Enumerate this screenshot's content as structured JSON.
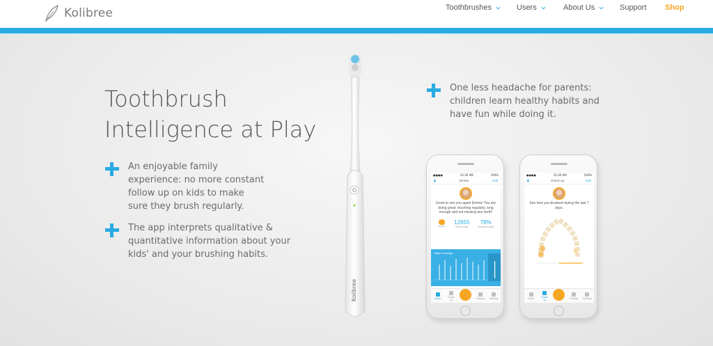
{
  "header": {
    "logo_text": "Kolibree",
    "nav": [
      {
        "label": "Toothbrushes",
        "has_dropdown": true
      },
      {
        "label": "Users",
        "has_dropdown": true
      },
      {
        "label": "About Us",
        "has_dropdown": true
      },
      {
        "label": "Support",
        "has_dropdown": false
      },
      {
        "label": "Shop",
        "has_dropdown": false
      }
    ],
    "accent_color": "#29abe2",
    "shop_color": "#f5a623"
  },
  "hero": {
    "title_line1": "Toothbrush",
    "title_line2": "Intelligence at Play",
    "features": [
      {
        "text": "An enjoyable family experience: no more constant follow up on kids to make sure they brush regularly."
      },
      {
        "text": "The app interprets qualitative & quantitative information about your kids' and your brushing habits."
      },
      {
        "text": "One less headache for parents: children learn healthy habits and have fun while doing it."
      }
    ],
    "brush_brand": "Kolibree"
  },
  "phone1": {
    "status_time": "10:30 AM",
    "status_battery": "100%",
    "title": "Emma",
    "edit": "Edit",
    "message": "Good to see you again Emma! You are doing great: brushing regularly, long enough and not missing any teeth!",
    "stats": [
      {
        "value": "",
        "label": "Level 3"
      },
      {
        "value": "12655",
        "label": "Total Points"
      },
      {
        "value": "78%",
        "label": "Brushed today"
      }
    ],
    "chart_title": "Daily brushings",
    "tabs": [
      "Home",
      "Check up",
      "",
      "Training",
      "Settings"
    ]
  },
  "phone2": {
    "status_time": "10:30 AM",
    "status_battery": "100%",
    "title": "Check up",
    "edit": "Edit",
    "message": "See how you brushed during the last 7 days.",
    "tabs": [
      "Home",
      "Check up",
      "",
      "Training",
      "Settings"
    ]
  }
}
